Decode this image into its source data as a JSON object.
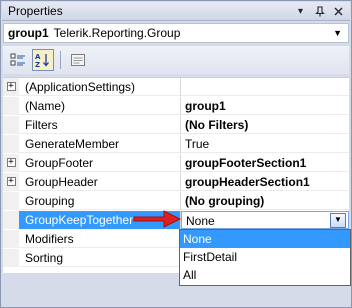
{
  "window": {
    "title": "Properties",
    "icons": [
      "dropdown-arrow-icon",
      "pin-icon",
      "close-icon"
    ]
  },
  "object_selector": {
    "name": "group1",
    "type": "Telerik.Reporting.Group"
  },
  "toolbar": {
    "buttons": [
      "categorized-icon",
      "alphabetical-icon",
      "property-pages-icon"
    ]
  },
  "properties": [
    {
      "name": "(ApplicationSettings)",
      "value": "",
      "expandable": true,
      "bold": false
    },
    {
      "name": "(Name)",
      "value": "group1",
      "expandable": false,
      "bold": true
    },
    {
      "name": "Filters",
      "value": "(No Filters)",
      "expandable": false,
      "bold": true
    },
    {
      "name": "GenerateMember",
      "value": "True",
      "expandable": false,
      "bold": false
    },
    {
      "name": "GroupFooter",
      "value": "groupFooterSection1",
      "expandable": true,
      "bold": true
    },
    {
      "name": "GroupHeader",
      "value": "groupHeaderSection1",
      "expandable": true,
      "bold": true
    },
    {
      "name": "Grouping",
      "value": "(No grouping)",
      "expandable": false,
      "bold": true
    },
    {
      "name": "GroupKeepTogether",
      "value": "None",
      "expandable": false,
      "bold": false,
      "selected": true
    },
    {
      "name": "Modifiers",
      "value": "",
      "expandable": false,
      "bold": false
    },
    {
      "name": "Sorting",
      "value": "",
      "expandable": false,
      "bold": false
    }
  ],
  "dropdown": {
    "options": [
      "None",
      "FirstDetail",
      "All"
    ],
    "highlighted": "None"
  },
  "colors": {
    "selection": "#3399ff",
    "annotation_arrow": "#e02020"
  }
}
